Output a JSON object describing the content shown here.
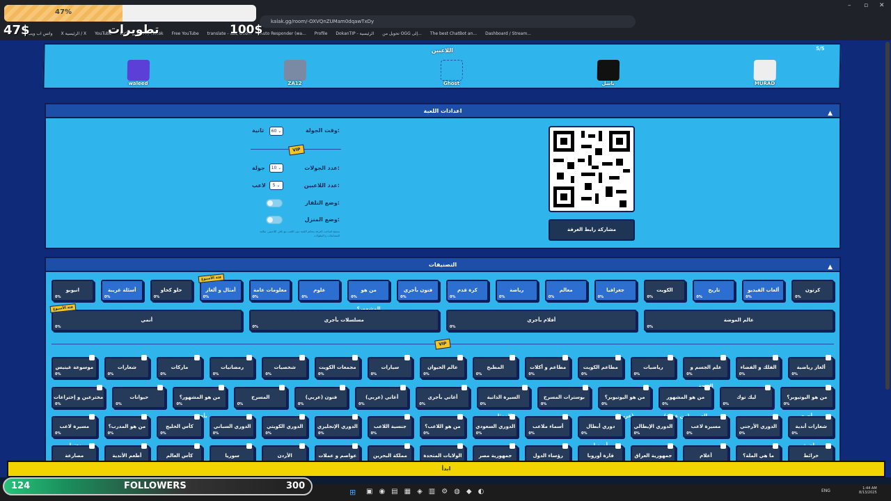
{
  "browser": {
    "address": "kalak.gg/room/-OXVQnZUMam0dqawTxDy",
    "bookmarks": [
      "واتس اب ويب",
      "X الرئيسية / X",
      "YouTube",
      "Kick",
      "(99+) TikTok",
      "Free YouTube",
      "translate - بحث Goo...",
      "Auto Responder (wa...",
      "Profile",
      "DokanTIP - الرئيسية",
      "تحويل من OGG إلى...",
      "The best ChatBot an...",
      "Dashboard / Stream..."
    ]
  },
  "overlay": {
    "progress_label": "47%",
    "progress": 0.47,
    "price_left": "47$",
    "title": "تطويرات",
    "price_right": "100$"
  },
  "players": {
    "title": "اللاعبين",
    "count": "5/5",
    "list": [
      {
        "name": "waleed",
        "color": "#5b3fd6"
      },
      {
        "name": "ZA12",
        "color": "#7a8aa5"
      },
      {
        "name": "Ghost",
        "color": "#2fb5ec"
      },
      {
        "name": "باسل",
        "color": "#111111"
      },
      {
        "name": "MURAD",
        "color": "#eeeeee"
      }
    ]
  },
  "settings": {
    "title": "اعدادات اللعبة",
    "round_time_label": "وقت الجولة:",
    "round_time_value": "60",
    "round_time_unit": "ثانية",
    "vip": "VIP",
    "rounds_label": "عدد الجولات:",
    "rounds_value": "10",
    "rounds_unit": "جولة",
    "players_label": "عدد اللاعبين:",
    "players_value": "5",
    "players_unit": "لاعب",
    "tv_mode": "وضع التلفاز:",
    "home_mode": "وضع المنزل:",
    "note": "يسمح لصاحب الغرفة بتحكم اللعبة دون اللعب مع باقي اللاعبين, مثالية للمسابقات و البطولات",
    "share_button": "مشاركة رابط الغرفة"
  },
  "categories": {
    "title": "التصنيفات",
    "vip": "VIP",
    "pct": "0%",
    "new_badge": "فئة الأسبوع",
    "row1": [
      "كرتون",
      "ألعاب الفيديو",
      "تاريخ",
      "الكويت",
      "جغرافيا",
      "معالم",
      "رياضة",
      "كرة قدم",
      "فنون بأجري",
      "من هو المشهور؟ (عربي)",
      "علوم",
      "معلومات عامة",
      "أمثال و ألغاز",
      "حلو كحاو",
      "أسئلة غريبة",
      "انيوبو"
    ],
    "row2": [
      "عالم الموضة",
      "أفلام بأجري",
      "مسلسلات بأجري",
      "أنمي"
    ],
    "grid1": [
      "ألغاز رياضية",
      "الفلك و الفضاء",
      "علم الجسم و الصحة",
      "رياضيات",
      "مطاعم الكويت",
      "مطاعم و أكلات",
      "المطبخ",
      "عالم الحيوان",
      "سيارات",
      "مجمعات الكويت",
      "شخصيات",
      "رمضانيات",
      "ماركات",
      "شعارات",
      "موسوعة غينيس"
    ],
    "grid2": [
      "من هو اليوتيوبر؟ بأجري",
      "ليك توك",
      "من هو المشهور العربي (من عيناه)",
      "من هو اليوتيوبر؟ (عربي)",
      "بوسترات المسرح",
      "السيرة الذاتية للممثل",
      "أغاني بأجري",
      "أغاني (عربي)",
      "فنون (عربي)",
      "المسرح",
      "من هو المشهور؟ بأجري",
      "حيوانات",
      "مخترعين و إختراعات"
    ],
    "grid3": [
      "شعارات أندية رياضية",
      "الدوري الأرجني",
      "مسيرة لاعب",
      "الدوري الإيطالي",
      "دوري أبطال أوروبا",
      "أسماء ملاعب",
      "الدوري السعودي",
      "من هو اللاعب؟",
      "جنسية اللاعب",
      "الدوري الإنجليزي",
      "الدوري الكويتي",
      "الدوري السباني",
      "كأس الخليج",
      "من هو المدرب؟",
      "مسيرة لاعب معتزل"
    ],
    "grid4": [
      "خرائط",
      "ما هي الملة؟",
      "أعلام",
      "جمهورية العراق",
      "قارة أوروبا",
      "رؤساء الدول",
      "جمهورية مصر",
      "الولايات المتحدة الأمريكية",
      "مملكة البحرين",
      "عواصم و عملات",
      "الأردن",
      "سوريا",
      "كأس العالم",
      "أطعم الأندية",
      "مصارعة"
    ]
  },
  "yt_bar": "ابدأ",
  "followers": {
    "current": "124",
    "label": "FOLLOWERS",
    "goal": "300"
  },
  "taskbar": {
    "lang": "ENG",
    "time": "1:44 AM",
    "date": "8/13/2025"
  }
}
